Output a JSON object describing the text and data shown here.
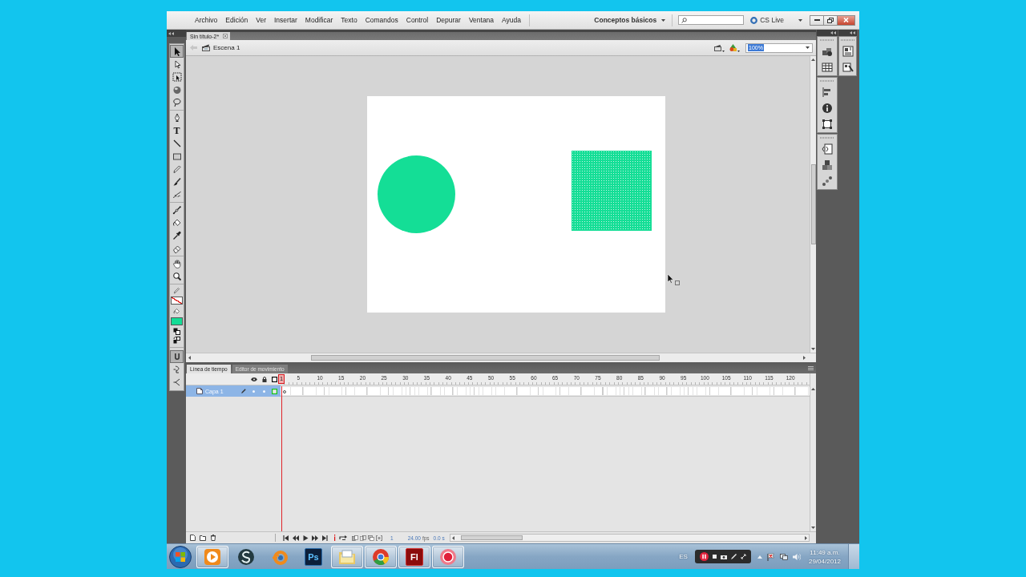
{
  "menu_bar": {
    "items": [
      "Archivo",
      "Edición",
      "Ver",
      "Insertar",
      "Modificar",
      "Texto",
      "Comandos",
      "Control",
      "Depurar",
      "Ventana",
      "Ayuda"
    ],
    "workspace": "Conceptos básicos",
    "cs_live": "CS Live"
  },
  "tools": {
    "items": [
      {
        "kind": "selection",
        "selected": true
      },
      {
        "kind": "subselection",
        "selected": false
      },
      {
        "kind": "free-transform",
        "selected": false
      },
      {
        "kind": "rotation-3d",
        "selected": false
      },
      {
        "kind": "lasso",
        "selected": false
      },
      {
        "kind": "pen",
        "selected": false
      },
      {
        "kind": "text",
        "glyph": "T",
        "selected": false
      },
      {
        "kind": "line",
        "selected": false
      },
      {
        "kind": "rectangle",
        "selected": false
      },
      {
        "kind": "pencil",
        "selected": false
      },
      {
        "kind": "brush",
        "selected": false
      },
      {
        "kind": "deco",
        "selected": false
      },
      {
        "kind": "bone",
        "selected": false
      },
      {
        "kind": "bucket",
        "selected": false
      },
      {
        "kind": "eyedropper",
        "selected": false
      },
      {
        "kind": "eraser",
        "selected": false
      },
      {
        "kind": "hand",
        "selected": false
      },
      {
        "kind": "zoom",
        "selected": false
      }
    ],
    "swatches": [
      {
        "kind": "stroke",
        "empty": true
      },
      {
        "kind": "fill",
        "empty": false,
        "color": "#14dc96"
      }
    ],
    "options": [
      {
        "kind": "snap",
        "on": true
      },
      {
        "kind": "smooth",
        "on": false
      },
      {
        "kind": "straighten",
        "on": false
      }
    ]
  },
  "document": {
    "tabs": [
      {
        "label": "Sin título-2*",
        "selected": true
      }
    ],
    "scene": "Escena 1",
    "zoom": {
      "value": "100%",
      "highlighted": true
    },
    "shapes": [
      {
        "kind": "circle",
        "selected": false
      },
      {
        "kind": "rectangle",
        "selected": true
      }
    ]
  },
  "timeline": {
    "tabs": [
      {
        "label": "Línea de tiempo",
        "selected": true
      },
      {
        "label": "Editor de movimiento",
        "selected": false
      }
    ],
    "playhead": "1",
    "ruler": [
      "5",
      "10",
      "15",
      "20",
      "25",
      "30",
      "35",
      "40",
      "45",
      "50",
      "55",
      "60",
      "65",
      "70",
      "75",
      "80",
      "85",
      "90",
      "95",
      "100",
      "105",
      "110",
      "115",
      "120"
    ],
    "layers": [
      {
        "name": "Capa 1",
        "selected": true
      }
    ],
    "current_frame": "1",
    "fps": "24.00",
    "fps_unit": "fps",
    "elapsed": "0.0 s"
  },
  "taskbar": {
    "apps": [
      {
        "kind": "media-player",
        "running": true
      },
      {
        "kind": "spiral-app",
        "running": false
      },
      {
        "kind": "ring-app",
        "running": false
      },
      {
        "kind": "photoshop",
        "label": "Ps",
        "running": false
      },
      {
        "kind": "folder",
        "running": true
      },
      {
        "kind": "browser",
        "running": true
      },
      {
        "kind": "flash",
        "label": "Fl",
        "running": true
      },
      {
        "kind": "recorder",
        "running": true
      }
    ],
    "language": "ES",
    "time": "11:49 a.m.",
    "date": "29/04/2012"
  }
}
